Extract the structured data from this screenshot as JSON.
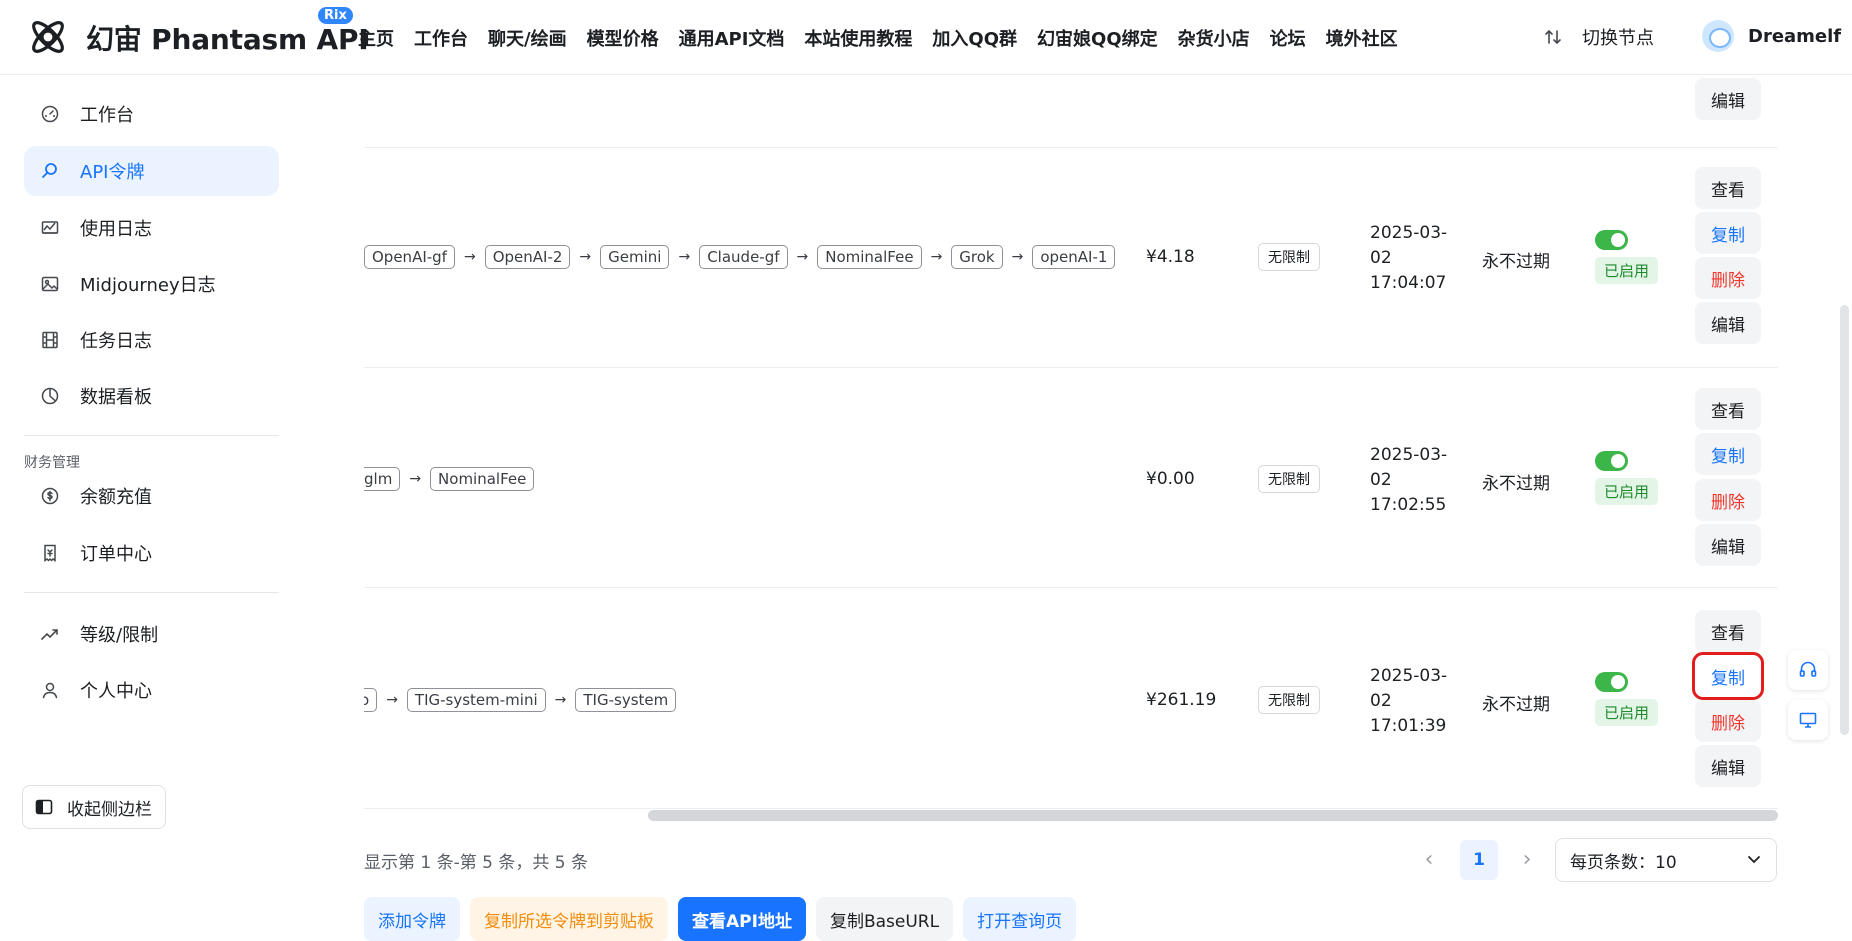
{
  "header": {
    "brand": "幻宙 Phantasm API",
    "brand_badge": "Rix",
    "nav": [
      "主页",
      "工作台",
      "聊天/绘画",
      "模型价格",
      "通用API文档",
      "本站使用教程",
      "加入QQ群",
      "幻宙娘QQ绑定",
      "杂货小店",
      "论坛",
      "境外社区"
    ],
    "switch_node": "切换节点",
    "username": "Dreamelf"
  },
  "sidebar": {
    "items": [
      {
        "label": "工作台",
        "icon": "dashboard-icon"
      },
      {
        "label": "API令牌",
        "icon": "search-icon"
      },
      {
        "label": "使用日志",
        "icon": "log-icon"
      },
      {
        "label": "Midjourney日志",
        "icon": "image-icon"
      },
      {
        "label": "任务日志",
        "icon": "film-icon"
      },
      {
        "label": "数据看板",
        "icon": "pie-chart-icon"
      }
    ],
    "group_title": "财务管理",
    "finance_items": [
      {
        "label": "余额充值",
        "icon": "coin-icon"
      },
      {
        "label": "订单中心",
        "icon": "order-icon"
      }
    ],
    "other_items": [
      {
        "label": "等级/限制",
        "icon": "trend-icon"
      },
      {
        "label": "个人中心",
        "icon": "user-icon"
      }
    ],
    "collapse_label": "收起侧边栏"
  },
  "table": {
    "rows": [
      {
        "chain": [
          "OpenAI-gf",
          "OpenAI-2",
          "Gemini",
          "Claude-gf",
          "NominalFee",
          "Grok",
          "openAI-1"
        ],
        "balance": "¥4.18",
        "limit": "无限制",
        "created": [
          "2025-03-",
          "02",
          "17:04:07"
        ],
        "expiry": "永不过期",
        "status": "已启用"
      },
      {
        "chain": [
          "glm",
          "NominalFee"
        ],
        "balance": "¥0.00",
        "limit": "无限制",
        "created": [
          "2025-03-",
          "02",
          "17:02:55"
        ],
        "expiry": "永不过期",
        "status": "已启用"
      },
      {
        "chain": [
          "o",
          "TIG-system-mini",
          "TIG-system"
        ],
        "balance": "¥261.19",
        "limit": "无限制",
        "created": [
          "2025-03-",
          "02",
          "17:01:39"
        ],
        "expiry": "永不过期",
        "status": "已启用"
      }
    ],
    "actions": {
      "view": "查看",
      "copy": "复制",
      "delete": "删除",
      "edit": "编辑"
    }
  },
  "pagination": {
    "range_text": "显示第 1 条-第 5 条，共 5 条",
    "current_page": "1",
    "per_page": "每页条数：10"
  },
  "bottom_buttons": [
    "添加令牌",
    "复制所选令牌到剪贴板",
    "查看API地址",
    "复制BaseURL",
    "打开查询页"
  ],
  "colors": {
    "accent": "#1874ff",
    "danger": "#f0352a",
    "success": "#3cb649",
    "warning": "#f28c0a"
  }
}
